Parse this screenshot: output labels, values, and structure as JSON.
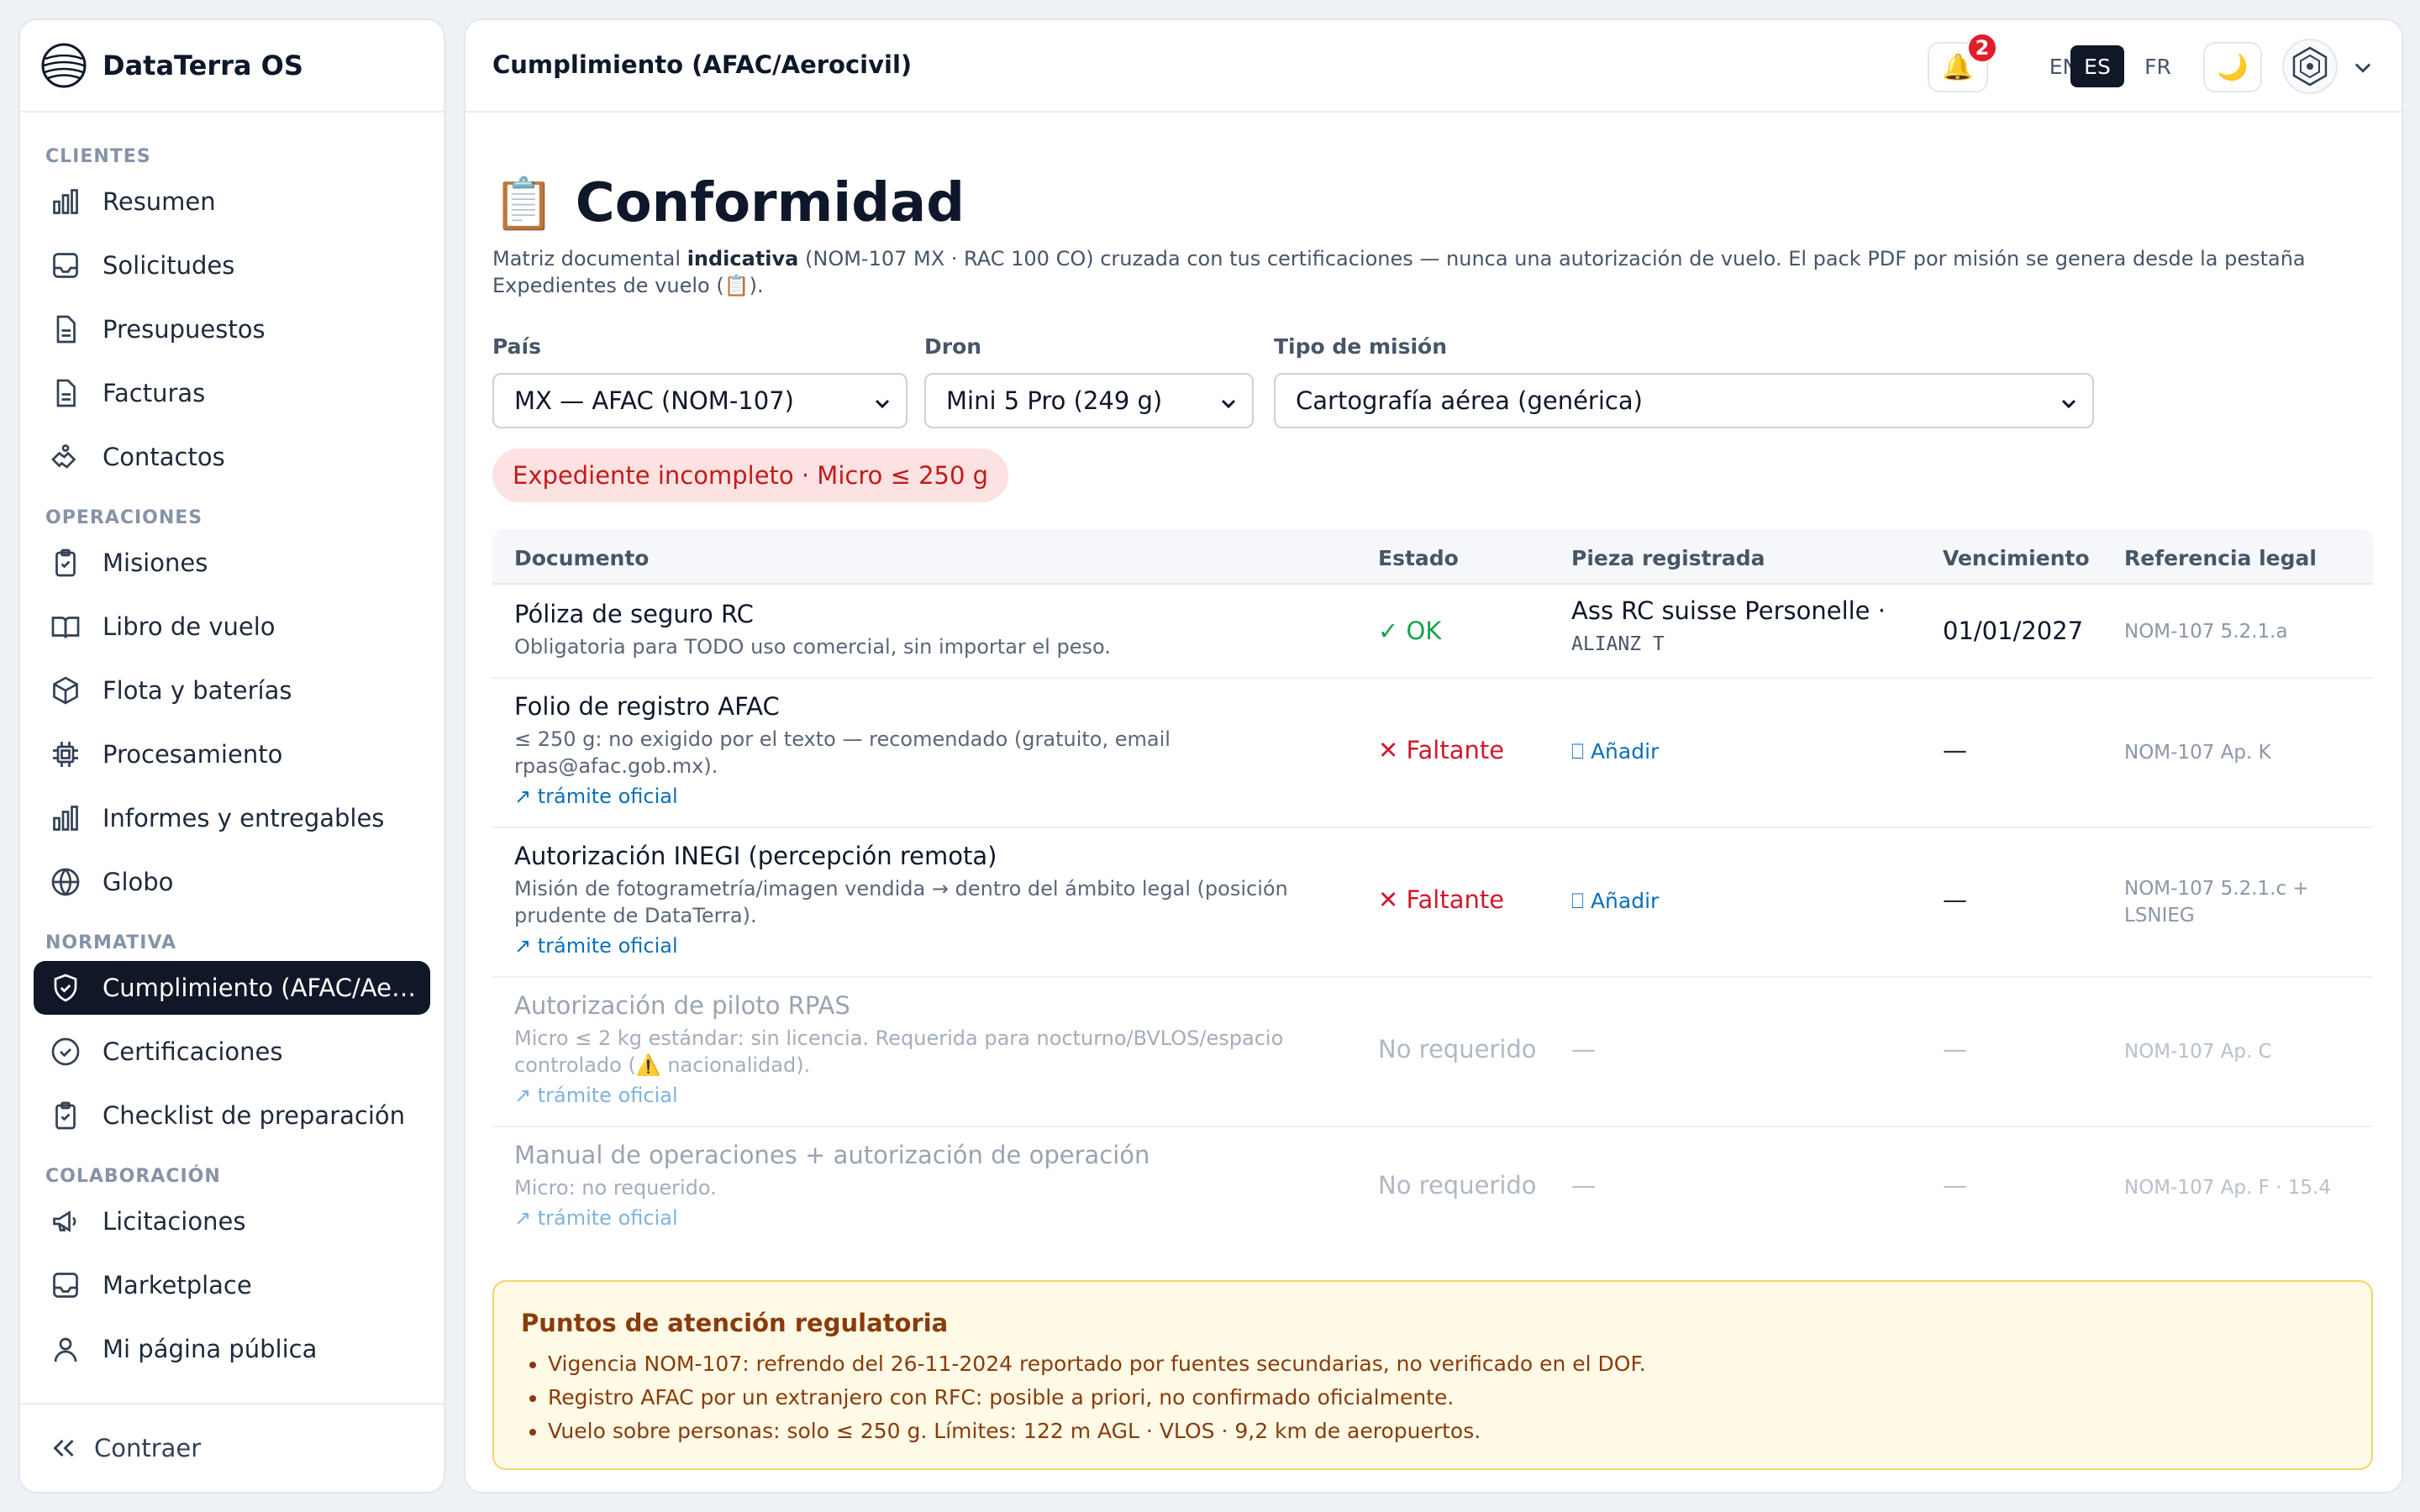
{
  "app": {
    "name": "DataTerra OS"
  },
  "sidebar": {
    "sections": [
      {
        "title": "CLIENTES",
        "items": [
          {
            "label": "Resumen",
            "icon": "bar-chart-icon"
          },
          {
            "label": "Solicitudes",
            "icon": "inbox-icon"
          },
          {
            "label": "Presupuestos",
            "icon": "file-icon"
          },
          {
            "label": "Facturas",
            "icon": "file-icon"
          },
          {
            "label": "Contactos",
            "icon": "handshake-icon"
          }
        ]
      },
      {
        "title": "OPERACIONES",
        "items": [
          {
            "label": "Misiones",
            "icon": "clipboard-icon"
          },
          {
            "label": "Libro de vuelo",
            "icon": "book-icon"
          },
          {
            "label": "Flota y baterías",
            "icon": "box-icon"
          },
          {
            "label": "Procesamiento",
            "icon": "chip-icon"
          },
          {
            "label": "Informes y entregables",
            "icon": "bar-chart-icon"
          },
          {
            "label": "Globo",
            "icon": "globe-icon"
          }
        ]
      },
      {
        "title": "NORMATIVA",
        "items": [
          {
            "label": "Cumplimiento (AFAC/Aerocivil)",
            "icon": "shield-icon",
            "active": true
          },
          {
            "label": "Certificaciones",
            "icon": "check-circle-icon"
          },
          {
            "label": "Checklist de preparación",
            "icon": "clipboard-check-icon"
          }
        ]
      },
      {
        "title": "COLABORACIÓN",
        "items": [
          {
            "label": "Licitaciones",
            "icon": "megaphone-icon"
          },
          {
            "label": "Marketplace",
            "icon": "inbox-icon"
          },
          {
            "label": "Mi página pública",
            "icon": "user-icon"
          }
        ]
      }
    ],
    "collapse_label": "Contraer"
  },
  "topbar": {
    "title": "Cumplimiento (AFAC/Aerocivil)",
    "notifications_count": "2",
    "bell_glyph": "🔔",
    "languages": [
      "EN",
      "ES",
      "FR"
    ],
    "active_language": "ES",
    "theme_glyph": "🌙"
  },
  "page": {
    "emoji": "📋",
    "title": "Conformidad",
    "intro_pre": "Matriz documental ",
    "intro_bold": "indicativa",
    "intro_post": " (NOM-107 MX · RAC 100 CO) cruzada con tus certificaciones — nunca una autorización de vuelo. El pack PDF por misión se genera desde la pestaña Expedientes de vuelo (📋).",
    "filters": {
      "country_label": "País",
      "country_value": "MX — AFAC (NOM-107)",
      "drone_label": "Dron",
      "drone_value": "Mini 5 Pro (249 g)",
      "mission_label": "Tipo de misión",
      "mission_value": "Cartografía aérea (genérica)"
    },
    "status_pill": "Expediente incompleto · Micro ≤ 250 g"
  },
  "table": {
    "headers": {
      "document": "Documento",
      "status": "Estado",
      "piece": "Pieza registrada",
      "expiry": "Vencimiento",
      "legal": "Referencia legal"
    },
    "rows": [
      {
        "title": "Póliza de seguro RC",
        "desc": "Obligatoria para TODO uso comercial, sin importar el peso.",
        "status": "✓ OK",
        "piece": "Ass RC suisse Personelle  ·",
        "piece_sub": "ALIANZ T",
        "expiry": "01/01/2027",
        "legal": "NOM-107 5.2.1.a"
      },
      {
        "title": "Folio de registro AFAC",
        "desc_line1": "≤ 250 g: no exigido por el texto — recomendado (gratuito, email",
        "desc_line2": "rpas@afac.gob.mx).",
        "link": "↗ trámite oficial",
        "status": "✕ Faltante",
        "add": "⎕ Añadir",
        "expiry": "—",
        "legal": "NOM-107 Ap. K"
      },
      {
        "title": "Autorización INEGI (percepción remota)",
        "desc_line1": "Misión de fotogrametría/imagen vendida → dentro del ámbito legal (posición",
        "desc_line2": "prudente de DataTerra).",
        "link": "↗ trámite oficial",
        "status": "✕ Faltante",
        "add": "⎕ Añadir",
        "expiry": "—",
        "legal_line1": "NOM-107 5.2.1.c +",
        "legal_line2": "LSNIEG"
      },
      {
        "title": "Autorización de piloto RPAS",
        "desc_line1": "Micro ≤ 2 kg estándar: sin licencia. Requerida para nocturno/BVLOS/espacio",
        "desc_line2": "controlado (⚠️ nacionalidad).",
        "link": "↗ trámite oficial",
        "status": "No requerido",
        "piece": "—",
        "expiry": "—",
        "legal": "NOM-107 Ap. C"
      },
      {
        "title": "Manual de operaciones + autorización de operación",
        "desc": "Micro: no requerido.",
        "link": "↗ trámite oficial",
        "status": "No requerido",
        "piece": "—",
        "expiry": "—",
        "legal": "NOM-107 Ap. F · 15.4"
      }
    ]
  },
  "notice": {
    "title": "Puntos de atención regulatoria",
    "items": [
      "Vigencia NOM-107: refrendo del 26-11-2024 reportado por fuentes secundarias, no verificado en el DOF.",
      "Registro AFAC por un extranjero con RFC: posible a priori, no confirmado oficialmente.",
      "Vuelo sobre personas: solo ≤ 250 g. Límites: 122 m AGL · VLOS · 9,2 km de aeropuertos."
    ]
  },
  "colors": {
    "active_nav": "#101827",
    "ok": "#16a34a",
    "missing": "#d0182a",
    "link": "#0b6fb8",
    "warning_text": "#8a3b0a",
    "warning_bg": "#fefae6"
  }
}
